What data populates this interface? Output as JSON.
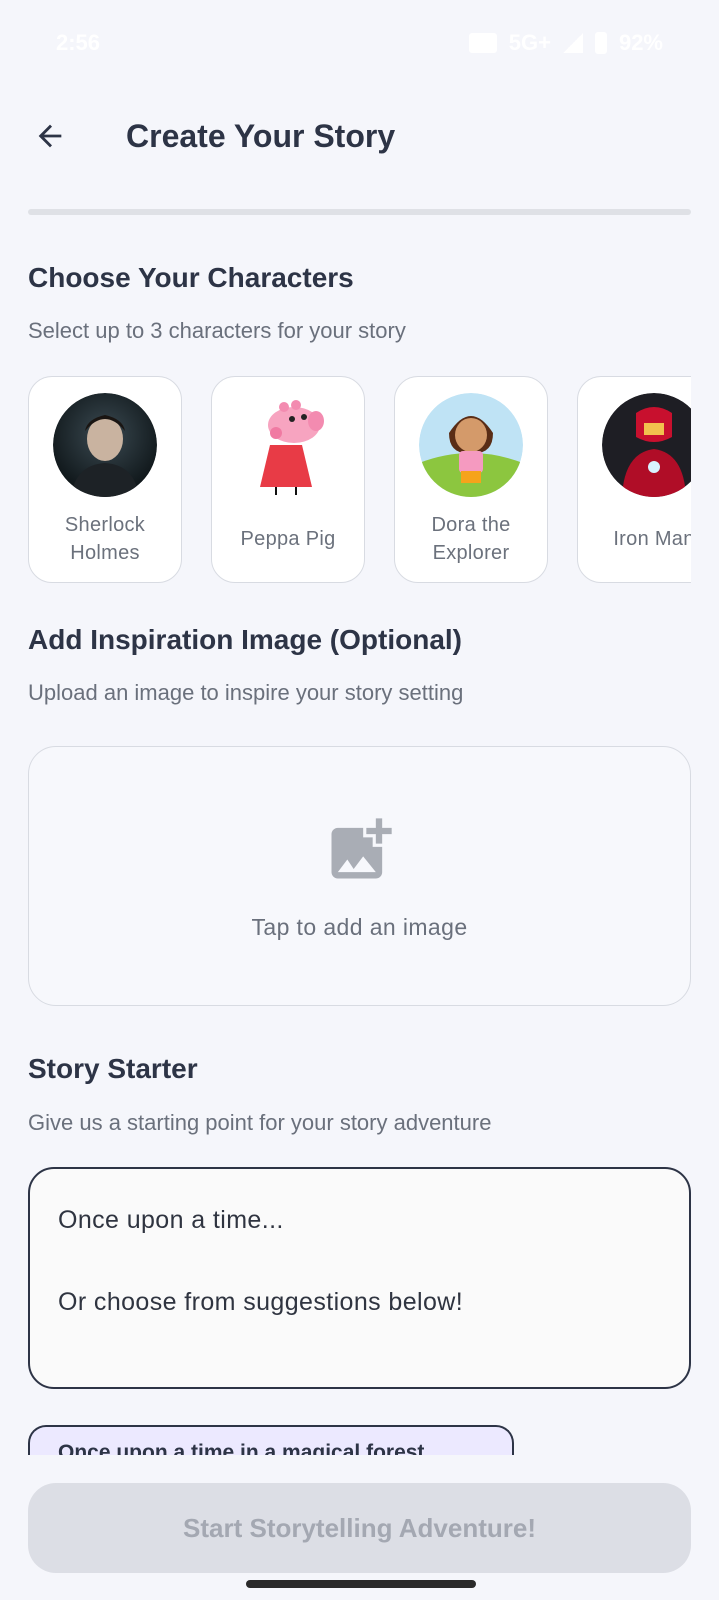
{
  "status_bar": {
    "time": "2:56",
    "network": "5G+",
    "battery": "92%"
  },
  "header": {
    "title": "Create Your Story",
    "back_icon": "arrow-left-icon"
  },
  "characters_section": {
    "title": "Choose Your Characters",
    "subtitle": "Select up to 3 characters for your story",
    "items": [
      {
        "name": "Sherlock Holmes"
      },
      {
        "name": "Peppa Pig"
      },
      {
        "name": "Dora the Explorer"
      },
      {
        "name": "Iron Man"
      }
    ]
  },
  "inspiration_section": {
    "title": "Add Inspiration Image (Optional)",
    "subtitle": "Upload an image to inspire your story setting",
    "upload_label": "Tap to add an image",
    "upload_icon": "add-photo-icon"
  },
  "starter_section": {
    "title": "Story Starter",
    "subtitle": "Give us a starting point for your story adventure",
    "placeholder_line1": "Once upon a time...",
    "placeholder_line2": "Or choose from suggestions below!",
    "suggestion": "Once upon a time in a magical forest..."
  },
  "cta": {
    "label": "Start Storytelling Adventure!"
  },
  "colors": {
    "background": "#f5f6fb",
    "title": "#2d3446",
    "muted": "#6a707c",
    "card_border": "#d8dbe2",
    "cta_bg": "#dcdee5",
    "cta_text": "#a4a8b2",
    "chip_bg": "#ece9ff"
  }
}
